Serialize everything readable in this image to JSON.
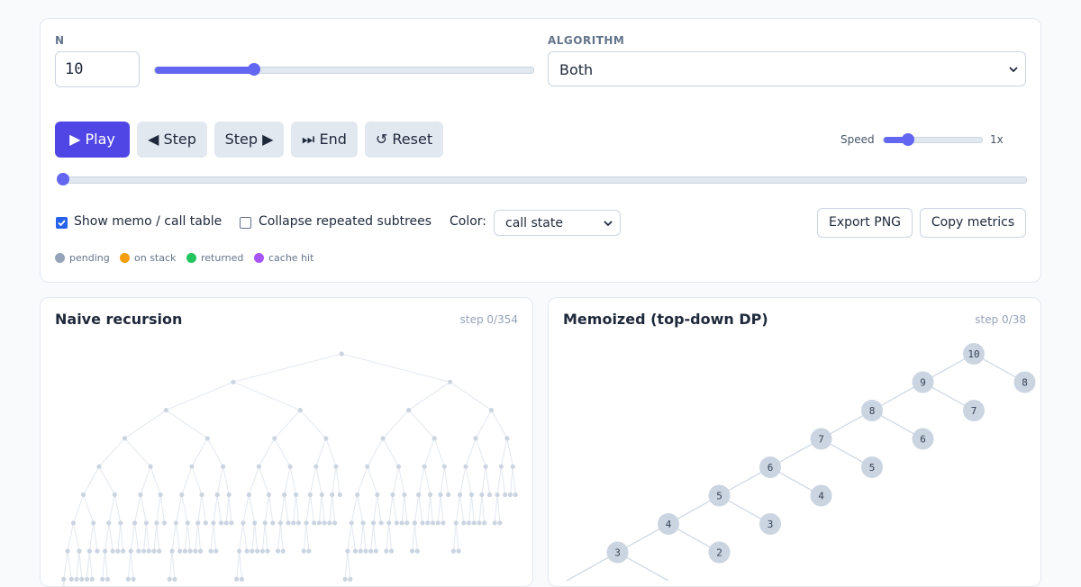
{
  "controls": {
    "n_label": "N",
    "n_value": "10",
    "n_slider_fraction": 0.26,
    "algorithm_label": "ALGORITHM",
    "algorithm_value": "Both",
    "buttons": {
      "play": "▶ Play",
      "step_back": "◀ Step",
      "step_fwd": "Step ▶",
      "end": "⏭ End",
      "reset": "↺ Reset"
    },
    "speed_label": "Speed",
    "speed_value": "1x",
    "speed_fraction": 0.24,
    "timeline_fraction": 0.0,
    "show_memo_label": "Show memo / call table",
    "show_memo_checked": true,
    "collapse_label": "Collapse repeated subtrees",
    "collapse_checked": false,
    "color_label": "Color:",
    "color_value": "call state",
    "export_png": "Export PNG",
    "copy_metrics": "Copy metrics"
  },
  "legend": [
    {
      "label": "pending",
      "color": "#94a3b8"
    },
    {
      "label": "on stack",
      "color": "#f59e0b"
    },
    {
      "label": "returned",
      "color": "#22c55e"
    },
    {
      "label": "cache hit",
      "color": "#a855f7"
    }
  ],
  "naive": {
    "title": "Naive recursion",
    "step": "step 0/354",
    "n": 10
  },
  "memo": {
    "title": "Memoized (top-down DP)",
    "step": "step 0/38",
    "nodes": [
      10,
      9,
      8,
      8,
      7,
      7,
      6,
      6,
      5,
      5,
      4,
      4,
      3,
      3,
      2
    ],
    "node_color": "#cbd5e1",
    "edge_color": "#cbd5e1"
  },
  "colors": {
    "accent": "#6366f1",
    "primary": "#4f46e5"
  }
}
